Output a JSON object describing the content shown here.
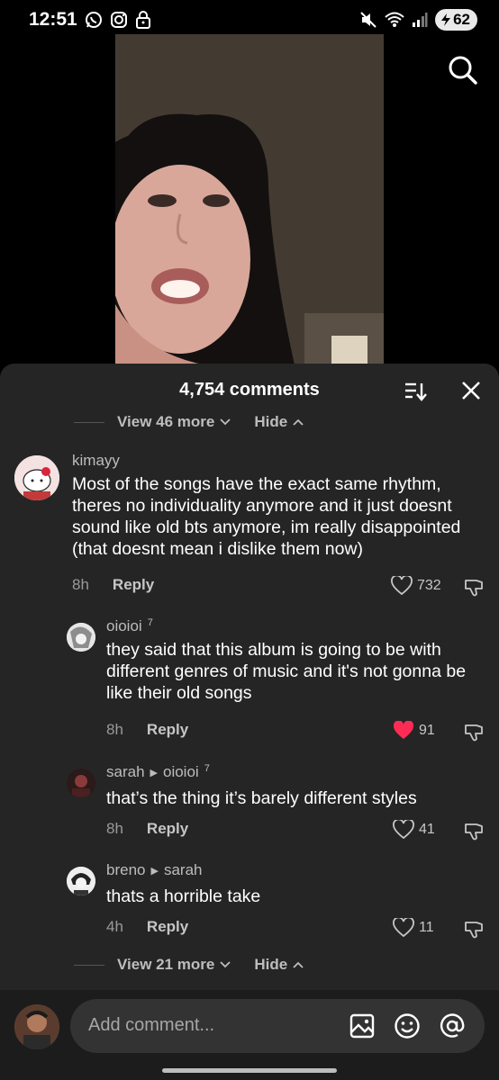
{
  "status_bar": {
    "time": "12:51",
    "battery": "62",
    "icons": [
      "whatsapp-icon",
      "instagram-icon",
      "lock-icon",
      "mute-icon",
      "wifi-icon",
      "signal-icon",
      "battery-icon"
    ]
  },
  "video": {
    "search_icon": "search-icon"
  },
  "sheet": {
    "title": "4,754 comments",
    "view_more_top": "View 46 more",
    "hide_top": "Hide",
    "view_more_bottom": "View 21 more",
    "hide_bottom": "Hide"
  },
  "comments": [
    {
      "user": "kimayy",
      "text": "Most of the songs have the exact same rhythm, theres no individuality anymore and it just doesnt sound like old bts anymore, im really disappointed (that doesnt mean i dislike them now)",
      "time": "8h",
      "reply": "Reply",
      "likes": "732",
      "liked": false
    },
    {
      "user": "oioioi",
      "user_badge": "7",
      "text": "they said that this album is going to be with different genres of music and it's not gonna be like their old songs",
      "time": "8h",
      "reply": "Reply",
      "likes": "91",
      "liked": true
    },
    {
      "user": "sarah",
      "reply_to": "oioioi",
      "reply_to_badge": "7",
      "text": "that’s the thing it’s barely different styles",
      "time": "8h",
      "reply": "Reply",
      "likes": "41",
      "liked": false
    },
    {
      "user": "breno",
      "reply_to": "sarah",
      "text": "thats a horrible take",
      "time": "4h",
      "reply": "Reply",
      "likes": "11",
      "liked": false
    }
  ],
  "input": {
    "placeholder": "Add comment..."
  },
  "colors": {
    "sheet_bg": "#252525",
    "liked_heart": "#fe2c55",
    "input_bg": "#333333"
  }
}
